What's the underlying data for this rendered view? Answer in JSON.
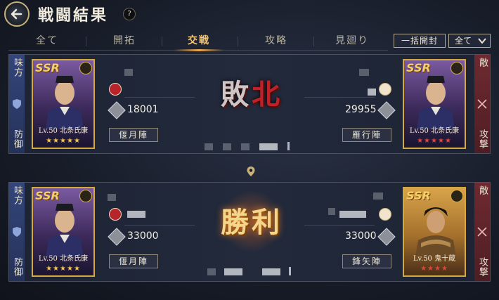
{
  "header": {
    "title": "戦闘結果",
    "help_label": "?"
  },
  "tabs": [
    {
      "label": "全て"
    },
    {
      "label": "開拓"
    },
    {
      "label": "交戦",
      "active": true
    },
    {
      "label": "攻略"
    },
    {
      "label": "見廻り"
    }
  ],
  "toolbar": {
    "bulk_open_label": "一括開封",
    "filter_label": "全て"
  },
  "colors": {
    "accent": "#f2c77a",
    "ally": "#33457a",
    "enemy": "#6e2a30"
  },
  "battles": [
    {
      "result": [
        "敗",
        "北"
      ],
      "ally": {
        "side_top": "味方",
        "side_bottom": "防御",
        "rarity": "SSR",
        "level_name": "Lv.50 北条氏康",
        "stars": "★★★★★",
        "power": "18001",
        "formation": "偃月陣"
      },
      "enemy": {
        "side_top": "敵",
        "side_bottom": "攻撃",
        "rarity": "SSR",
        "level_name": "Lv.50 北条氏康",
        "stars": "★★★★★",
        "power": "29955",
        "formation": "雁行陣"
      }
    },
    {
      "result": [
        "勝",
        "利"
      ],
      "ally": {
        "side_top": "味方",
        "side_bottom": "防御",
        "rarity": "SSR",
        "level_name": "Lv.50 北条氏康",
        "stars": "★★★★★",
        "power": "33000",
        "formation": "偃月陣"
      },
      "enemy": {
        "side_top": "敵",
        "side_bottom": "攻撃",
        "rarity": "SSR",
        "level_name": "Lv.50 鬼十蔵",
        "stars": "★★★★",
        "power": "33000",
        "formation": "鋒矢陣"
      }
    }
  ]
}
